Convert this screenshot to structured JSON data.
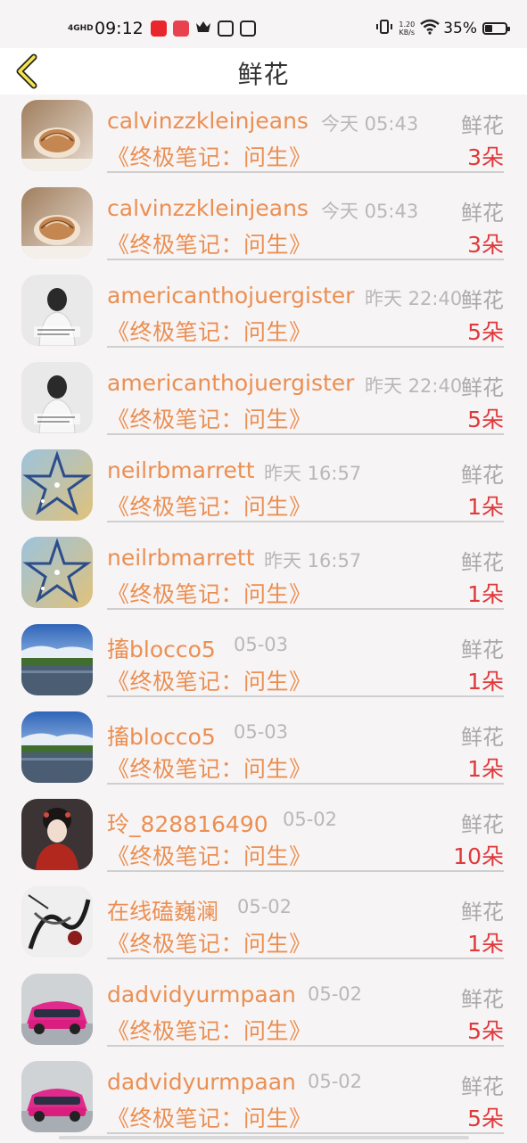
{
  "status_bar": {
    "network": "4GHD",
    "time": "09:12",
    "speed_value": "1.20",
    "speed_unit": "KB/s",
    "battery_percent": "35%",
    "battery_level": 0.35
  },
  "header": {
    "title": "鲜花"
  },
  "colors": {
    "accent": "#eb8f52",
    "count_red": "#e0393b",
    "muted": "#b8b8b8"
  },
  "items": [
    {
      "avatar": "seashell-avatar",
      "username": "calvinzzkleinjeans",
      "time": "今天 05:43",
      "label": "鲜花",
      "book": "《终极笔记：问生》",
      "count": "3朵"
    },
    {
      "avatar": "seashell-avatar",
      "username": "calvinzzkleinjeans",
      "time": "今天 05:43",
      "label": "鲜花",
      "book": "《终极笔记：问生》",
      "count": "3朵"
    },
    {
      "avatar": "girl-back-avatar",
      "username": "americanthojuergister",
      "time": "昨天 22:40",
      "label": "鲜花",
      "book": "《终极笔记：问生》",
      "count": "5朵"
    },
    {
      "avatar": "girl-back-avatar",
      "username": "americanthojuergister",
      "time": "昨天 22:40",
      "label": "鲜花",
      "book": "《终极笔记：问生》",
      "count": "5朵"
    },
    {
      "avatar": "star-avatar",
      "username": "neilrbmarrett",
      "time": "昨天 16:57",
      "label": "鲜花",
      "book": "《终极笔记：问生》",
      "count": "1朵"
    },
    {
      "avatar": "star-avatar",
      "username": "neilrbmarrett",
      "time": "昨天 16:57",
      "label": "鲜花",
      "book": "《终极笔记：问生》",
      "count": "1朵"
    },
    {
      "avatar": "landscape-avatar",
      "username": "搐blocco5",
      "time": "05-03",
      "label": "鲜花",
      "book": "《终极笔记：问生》",
      "count": "1朵"
    },
    {
      "avatar": "landscape-avatar",
      "username": "搐blocco5",
      "time": "05-03",
      "label": "鲜花",
      "book": "《终极笔记：问生》",
      "count": "1朵"
    },
    {
      "avatar": "hanfu-girl-avatar",
      "username": "玲_828816490",
      "time": "05-02",
      "label": "鲜花",
      "book": "《终极笔记：问生》",
      "count": "10朵"
    },
    {
      "avatar": "ink-art-avatar",
      "username": "在线磕巍澜",
      "time": "05-02",
      "label": "鲜花",
      "book": "《终极笔记：问生》",
      "count": "1朵"
    },
    {
      "avatar": "pink-car-avatar",
      "username": "dadvidyurmpaan",
      "time": "05-02",
      "label": "鲜花",
      "book": "《终极笔记：问生》",
      "count": "5朵"
    },
    {
      "avatar": "pink-car-avatar",
      "username": "dadvidyurmpaan",
      "time": "05-02",
      "label": "鲜花",
      "book": "《终极笔记：问生》",
      "count": "5朵"
    }
  ]
}
